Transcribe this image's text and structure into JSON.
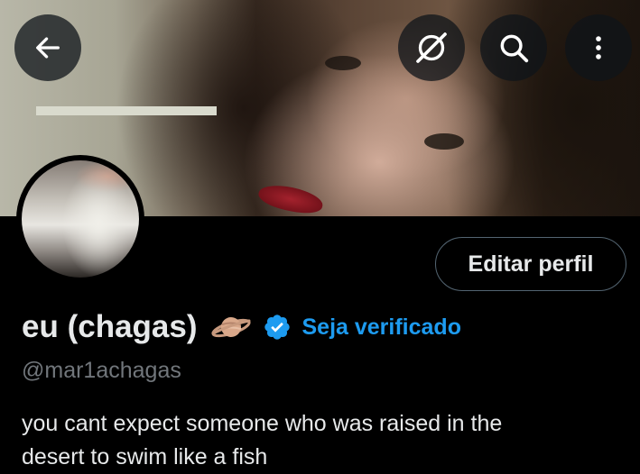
{
  "header": {
    "back_icon": "arrow-left-icon",
    "grok_icon": "grok-icon",
    "search_icon": "search-icon",
    "more_icon": "more-vertical-icon"
  },
  "profile": {
    "display_name": "eu (chagas)",
    "name_emoji": "ringed-planet-icon",
    "handle": "@mar1achagas",
    "edit_button_label": "Editar perfil",
    "verify_link_label": "Seja verificado",
    "bio_line1": "you cant expect someone who was raised in the",
    "bio_line2": "desert to swim like a fish"
  },
  "colors": {
    "background": "#000000",
    "text_primary": "#e7e9ea",
    "text_secondary": "#71767b",
    "accent": "#1d9bf0",
    "button_border": "#536471"
  }
}
